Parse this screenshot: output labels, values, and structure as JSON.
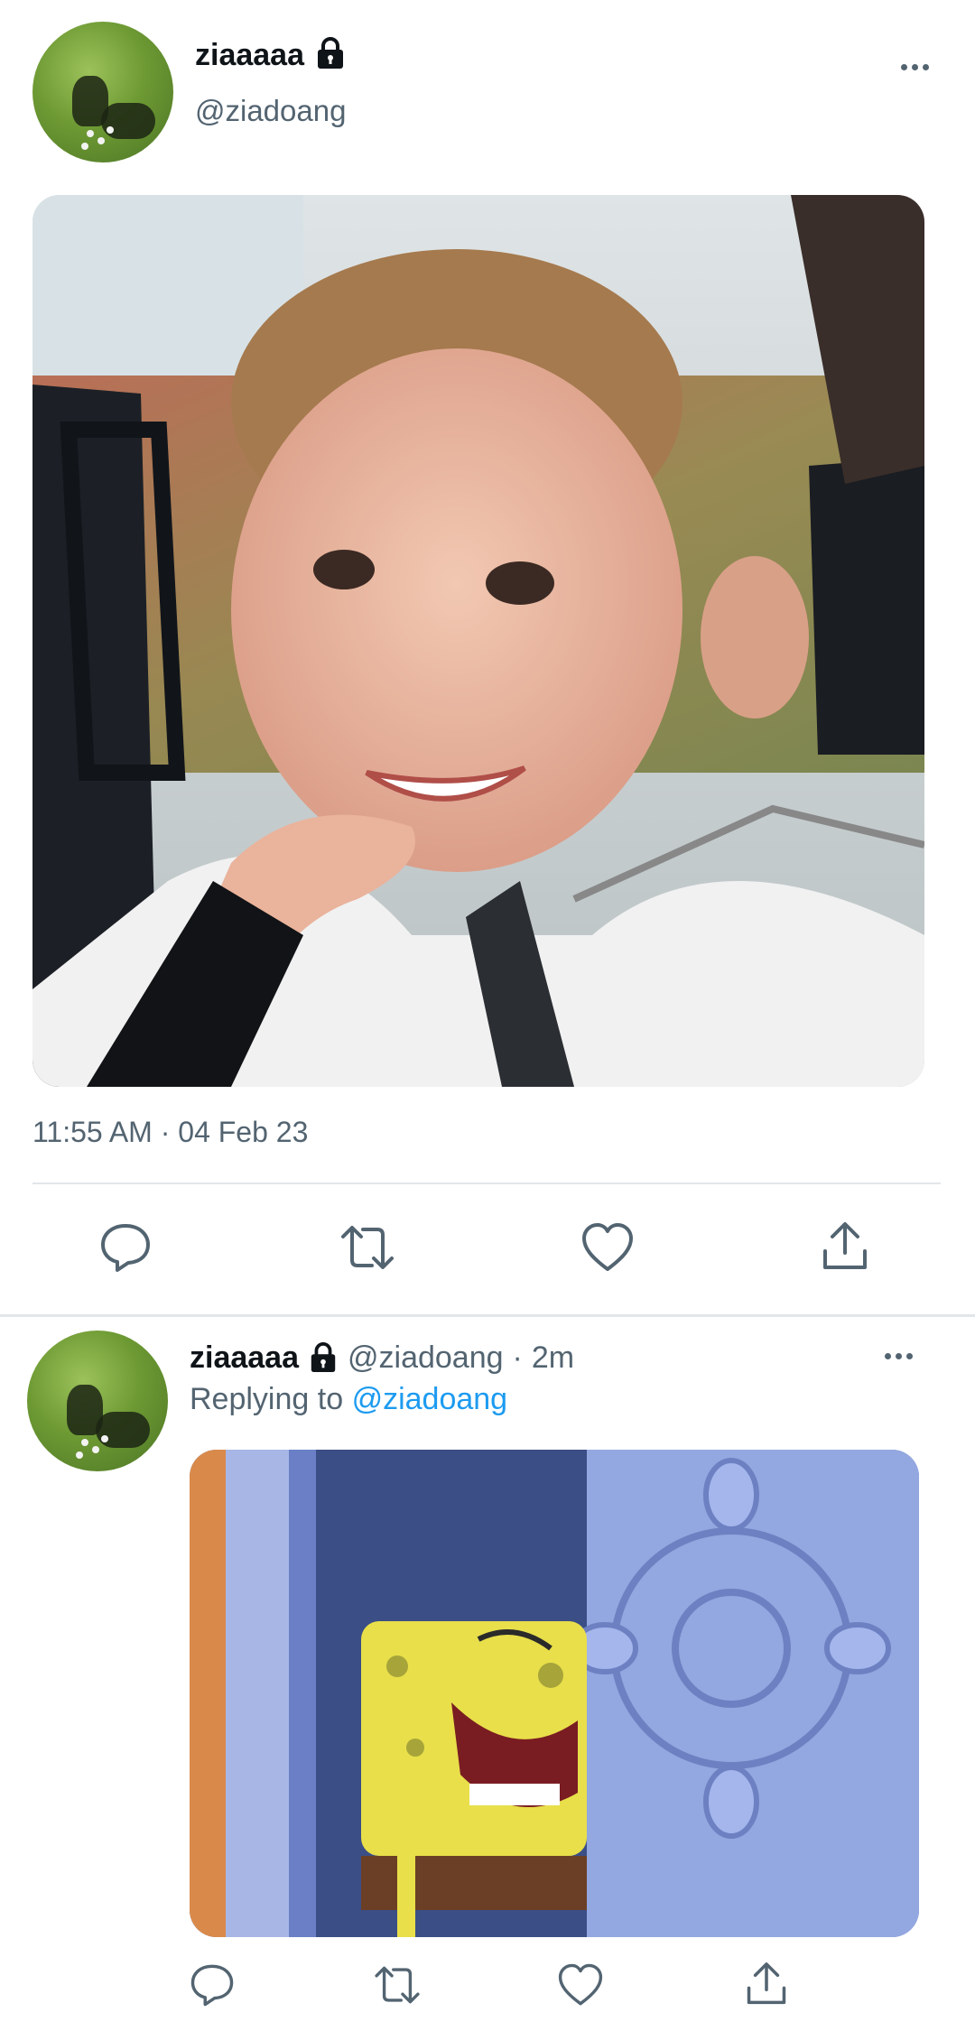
{
  "main_tweet": {
    "display_name": "ziaaaaa",
    "handle": "@ziadoang",
    "timestamp": "11:55 AM · 04 Feb 23",
    "icons": {
      "lock": "lock-icon",
      "more": "more-options-icon",
      "reply": "reply-icon",
      "retweet": "retweet-icon",
      "like": "heart-icon",
      "share": "share-icon"
    }
  },
  "reply_tweet": {
    "display_name": "ziaaaaa",
    "handle": "@ziadoang",
    "separator": "·",
    "time_ago": "2m",
    "replying_prefix": "Replying to",
    "replying_to": "@ziadoang"
  },
  "colors": {
    "text_primary": "#0f1419",
    "text_secondary": "#536471",
    "link": "#1d9bf0",
    "divider": "#e1e6ea"
  }
}
